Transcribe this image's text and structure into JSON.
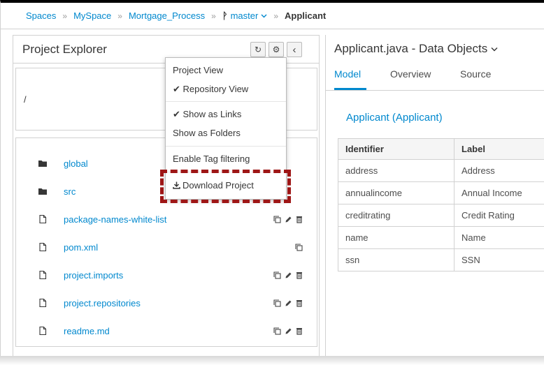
{
  "breadcrumb": {
    "spaces": "Spaces",
    "sep": "»",
    "space": "MySpace",
    "project": "Mortgage_Process",
    "branch_icon": "ᚹ",
    "branch": "master",
    "current": "Applicant"
  },
  "explorer": {
    "title": "Project Explorer",
    "refresh_glyph": "↻",
    "settings_glyph": "⚙",
    "collapse_glyph": "‹",
    "path": "/",
    "files": [
      {
        "name": "global",
        "type": "folder"
      },
      {
        "name": "src",
        "type": "folder"
      },
      {
        "name": "package-names-white-list",
        "type": "file"
      },
      {
        "name": "pom.xml",
        "type": "file"
      },
      {
        "name": "project.imports",
        "type": "file"
      },
      {
        "name": "project.repositories",
        "type": "file"
      },
      {
        "name": "readme.md",
        "type": "file"
      }
    ]
  },
  "dropdown": {
    "project_view": "Project View",
    "repository_view": "✔ Repository View",
    "show_as_links": "✔ Show as Links",
    "show_as_folders": "Show as Folders",
    "enable_tag_filtering": "Enable Tag filtering",
    "download_project": "Download Project"
  },
  "editor": {
    "title": "Applicant.java - Data Objects",
    "tabs": [
      "Model",
      "Overview",
      "Source"
    ],
    "object_title": "Applicant (Applicant)",
    "columns": [
      "Identifier",
      "Label"
    ],
    "rows": [
      [
        "address",
        "Address"
      ],
      [
        "annualincome",
        "Annual Income"
      ],
      [
        "creditrating",
        "Credit Rating"
      ],
      [
        "name",
        "Name"
      ],
      [
        "ssn",
        "SSN"
      ]
    ]
  },
  "colors": {
    "link": "#0088ce",
    "highlight": "#9e1616",
    "text": "#363636"
  }
}
